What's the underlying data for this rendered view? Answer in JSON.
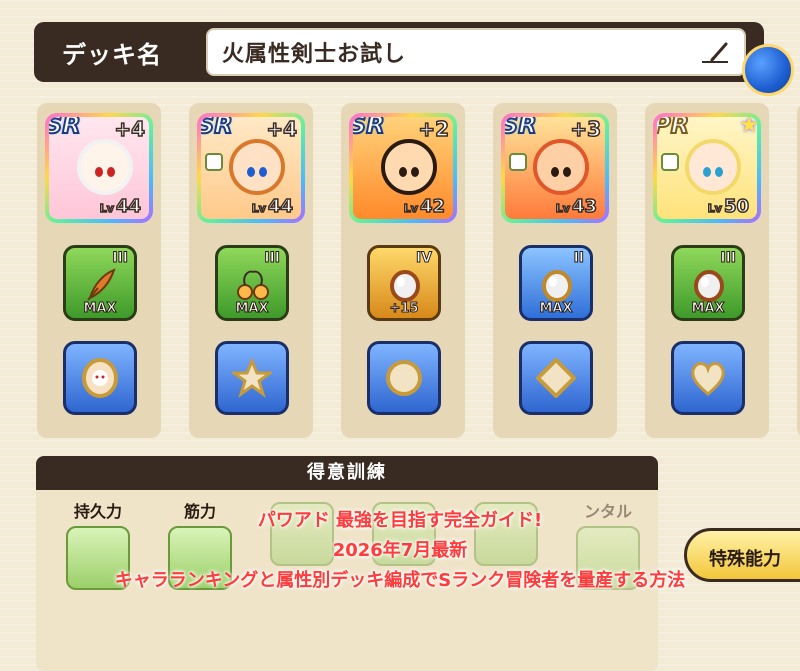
{
  "header": {
    "deck_label": "デッキ名",
    "deck_name": "火属性剣士お試し"
  },
  "cards": [
    {
      "rarity": "SR",
      "bonus": "+4",
      "level_prefix": "Lv",
      "level": "44",
      "equip_rank": "III",
      "equip_foot": "MAX",
      "equip_color": "green"
    },
    {
      "rarity": "SR",
      "bonus": "+4",
      "level_prefix": "Lv",
      "level": "44",
      "equip_rank": "III",
      "equip_foot": "MAX",
      "equip_color": "green"
    },
    {
      "rarity": "SR",
      "bonus": "+2",
      "level_prefix": "Lv",
      "level": "42",
      "equip_rank": "IV",
      "equip_foot": "+15",
      "equip_color": "gold"
    },
    {
      "rarity": "SR",
      "bonus": "+3",
      "level_prefix": "Lv",
      "level": "43",
      "equip_rank": "II",
      "equip_foot": "MAX",
      "equip_color": "blue"
    },
    {
      "rarity": "PR",
      "bonus": "",
      "level_prefix": "Lv",
      "level": "50",
      "equip_rank": "III",
      "equip_foot": "MAX",
      "equip_color": "green"
    }
  ],
  "training": {
    "title": "得意訓練",
    "items": [
      "持久力",
      "筋力",
      "",
      "",
      "",
      "ンタル"
    ]
  },
  "special_button": {
    "label": "特殊能力"
  },
  "caption": {
    "line1": "パワアド 最強を目指す完全ガイド!",
    "line2": "2026年7月最新",
    "line3": "キャラランキングと属性別デッキ編成でSランク冒険者を量産する方法"
  },
  "colors": {
    "header_bg": "#3a2b22",
    "page_bg": "#f3ebd6",
    "caption_red": "#ff3b3b"
  }
}
